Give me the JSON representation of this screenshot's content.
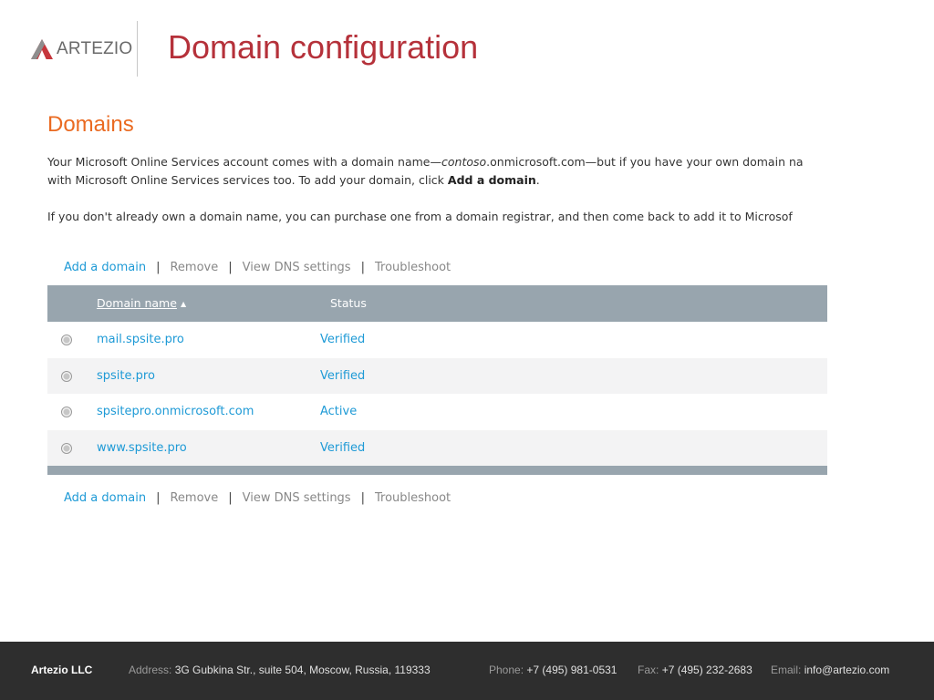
{
  "header": {
    "logo_text": "ARTEZIO",
    "title": "Domain configuration"
  },
  "main": {
    "section_title": "Domains",
    "para1": {
      "line1_a": "Your Microsoft Online Services account comes with a domain name—",
      "line1_italic": "contoso",
      "line1_b": ".onmicrosoft.com—but if you have your own domain na",
      "line2_a": "with Microsoft Online Services services too. To add your domain, click ",
      "line2_bold": "Add a domain",
      "line2_b": "."
    },
    "para2": "If you don't already own a domain name, you can purchase one from a domain registrar, and then come back to add it to Microsof"
  },
  "actions": {
    "add": "Add a domain",
    "remove": "Remove",
    "view_dns": "View DNS settings",
    "troubleshoot": "Troubleshoot",
    "separator": "|"
  },
  "table": {
    "col_domain": "Domain name",
    "col_status": "Status",
    "sort_glyph": "▲",
    "rows": [
      {
        "domain": "mail.spsite.pro",
        "status": "Verified"
      },
      {
        "domain": "spsite.pro",
        "status": "Verified"
      },
      {
        "domain": "spsitepro.onmicrosoft.com",
        "status": "Active"
      },
      {
        "domain": "www.spsite.pro",
        "status": "Verified"
      }
    ]
  },
  "footer": {
    "company": "Artezio LLC",
    "address_label": "Address:",
    "address": "3G Gubkina Str., suite 504, Moscow, Russia, 119333",
    "phone_label": "Phone:",
    "phone": "+7 (495) 981-0531",
    "fax_label": "Fax:",
    "fax": "+7 (495) 232-2683",
    "email_label": "Email:",
    "email": "info@artezio.com"
  },
  "colors": {
    "title_red": "#b5313a",
    "section_orange": "#ea6a21",
    "link_blue": "#1e9ad6",
    "table_header": "#98a5ae",
    "footer_bg": "#2e2e2e"
  },
  "icons": {
    "logo": "artezio-logo-icon",
    "sort": "sort-ascending-icon",
    "radio": "radio-button"
  }
}
